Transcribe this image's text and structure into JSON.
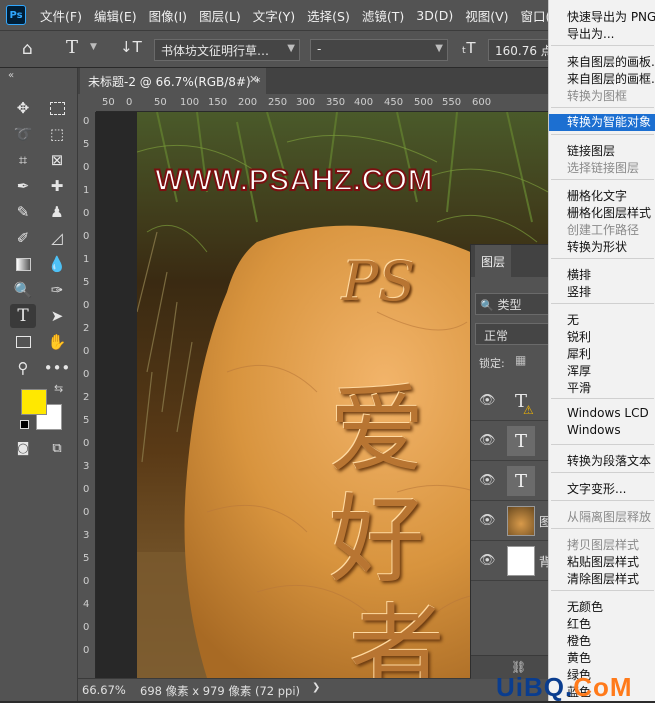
{
  "app": {
    "logo": "Ps"
  },
  "menubar": [
    "文件(F)",
    "编辑(E)",
    "图像(I)",
    "图层(L)",
    "文字(Y)",
    "选择(S)",
    "滤镜(T)",
    "3D(D)",
    "视图(V)",
    "窗口(W)"
  ],
  "options": {
    "font_family": "书体坊文征明行草…",
    "font_style": "-",
    "font_size": "160.76 点"
  },
  "document": {
    "tab_title": "未标题-2 @ 66.7%(RGB/8#) *",
    "ruler_h": [
      "50",
      "0",
      "50",
      "100",
      "150",
      "200",
      "250",
      "300",
      "350",
      "400",
      "450",
      "500",
      "550",
      "600"
    ],
    "ruler_v": [
      "0",
      "5",
      "0",
      "1",
      "0",
      "0",
      "1",
      "5",
      "0",
      "2",
      "0",
      "0",
      "2",
      "5",
      "0",
      "3",
      "0",
      "0",
      "3",
      "5",
      "0",
      "4",
      "0",
      "0"
    ]
  },
  "canvas": {
    "overlay_text": "WWW.PSAHZ.COM",
    "carved_text": [
      "PS",
      "爱",
      "好",
      "者"
    ]
  },
  "status": {
    "zoom": "66.67%",
    "doc_info": "698 像素 x 979 像素 (72 ppi)"
  },
  "layers_panel": {
    "title": "图层",
    "filter": "类型",
    "blend": "正常",
    "lock": "锁定:",
    "rows": [
      {
        "icon": "T",
        "name": ""
      },
      {
        "icon": "T",
        "name": ""
      },
      {
        "icon": "T",
        "name": ""
      },
      {
        "icon": "",
        "name": "图"
      },
      {
        "icon": "",
        "name": "背"
      }
    ]
  },
  "context_menu": {
    "items": [
      {
        "label": "快速导出为 PNG",
        "disabled": false
      },
      {
        "label": "导出为...",
        "disabled": false
      },
      {
        "label": "来自图层的画板...",
        "disabled": false
      },
      {
        "label": "来自图层的画框...",
        "disabled": false
      },
      {
        "label": "转换为图框",
        "disabled": true
      },
      {
        "label": "转换为智能对象",
        "disabled": false,
        "highlighted": true
      },
      {
        "label": "链接图层",
        "disabled": false
      },
      {
        "label": "选择链接图层",
        "disabled": true
      },
      {
        "label": "栅格化文字",
        "disabled": false
      },
      {
        "label": "栅格化图层样式",
        "disabled": false
      },
      {
        "label": "创建工作路径",
        "disabled": true
      },
      {
        "label": "转换为形状",
        "disabled": false
      },
      {
        "label": "横排",
        "disabled": false
      },
      {
        "label": "竖排",
        "disabled": false
      },
      {
        "label": "无",
        "disabled": false
      },
      {
        "label": "锐利",
        "disabled": false
      },
      {
        "label": "犀利",
        "disabled": false
      },
      {
        "label": "浑厚",
        "disabled": false
      },
      {
        "label": "平滑",
        "disabled": false
      },
      {
        "label": "Windows LCD",
        "disabled": false
      },
      {
        "label": "Windows",
        "disabled": false
      },
      {
        "label": "转换为段落文本",
        "disabled": false
      },
      {
        "label": "文字变形...",
        "disabled": false
      },
      {
        "label": "从隔离图层释放",
        "disabled": true
      },
      {
        "label": "拷贝图层样式",
        "disabled": true
      },
      {
        "label": "粘贴图层样式",
        "disabled": false
      },
      {
        "label": "清除图层样式",
        "disabled": false
      },
      {
        "label": "无颜色",
        "disabled": false
      },
      {
        "label": "红色",
        "disabled": false
      },
      {
        "label": "橙色",
        "disabled": false
      },
      {
        "label": "黄色",
        "disabled": false
      },
      {
        "label": "绿色",
        "disabled": false
      },
      {
        "label": "蓝色",
        "disabled": false
      }
    ]
  },
  "watermark": {
    "text_a": "UiBQ.",
    "text_b": "CoM"
  },
  "colors": {
    "foreground": "#ffe800",
    "background": "#ffffff",
    "menu_highlight": "#1c6fd1"
  }
}
